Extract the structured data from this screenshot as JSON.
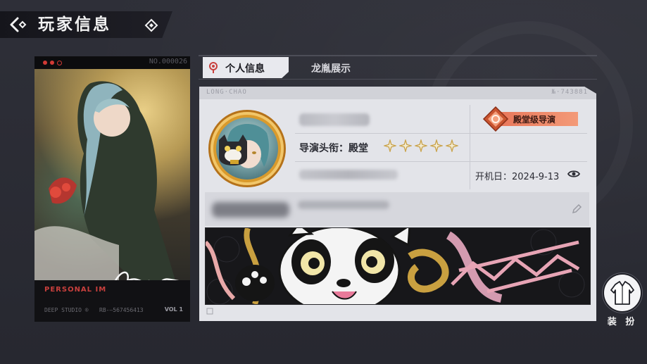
{
  "header": {
    "title": "玩家信息",
    "back_icon": "back-arrow-icon",
    "deco_icon": "diamond-icon"
  },
  "card": {
    "code": "NO.000026",
    "personal_text": "PERSONAL IM",
    "studio": "DEEP STUDIO ®",
    "serial": "RB-—567456413",
    "vol": "VOL 1"
  },
  "tabs": [
    {
      "label": "个人信息",
      "active": true
    },
    {
      "label": "龙胤展示",
      "active": false
    }
  ],
  "panel": {
    "strip_left": "LONG·CHAO",
    "strip_right": "№·743881",
    "badge_label": "殿堂级导演",
    "title_label": "导演头衔：殿堂",
    "stars": 5,
    "start_date_label": "开机日：2024-9-13",
    "eye_icon": "eye-icon",
    "edit_icon": "edit-icon"
  },
  "dress": {
    "label": "装 扮",
    "icon": "jacket-icon"
  },
  "colors": {
    "background": "#2b2c35",
    "panel": "#e3e4e9",
    "badge": "#f08a6a",
    "star": "#c9a24a",
    "accent_red": "#c9403d"
  }
}
